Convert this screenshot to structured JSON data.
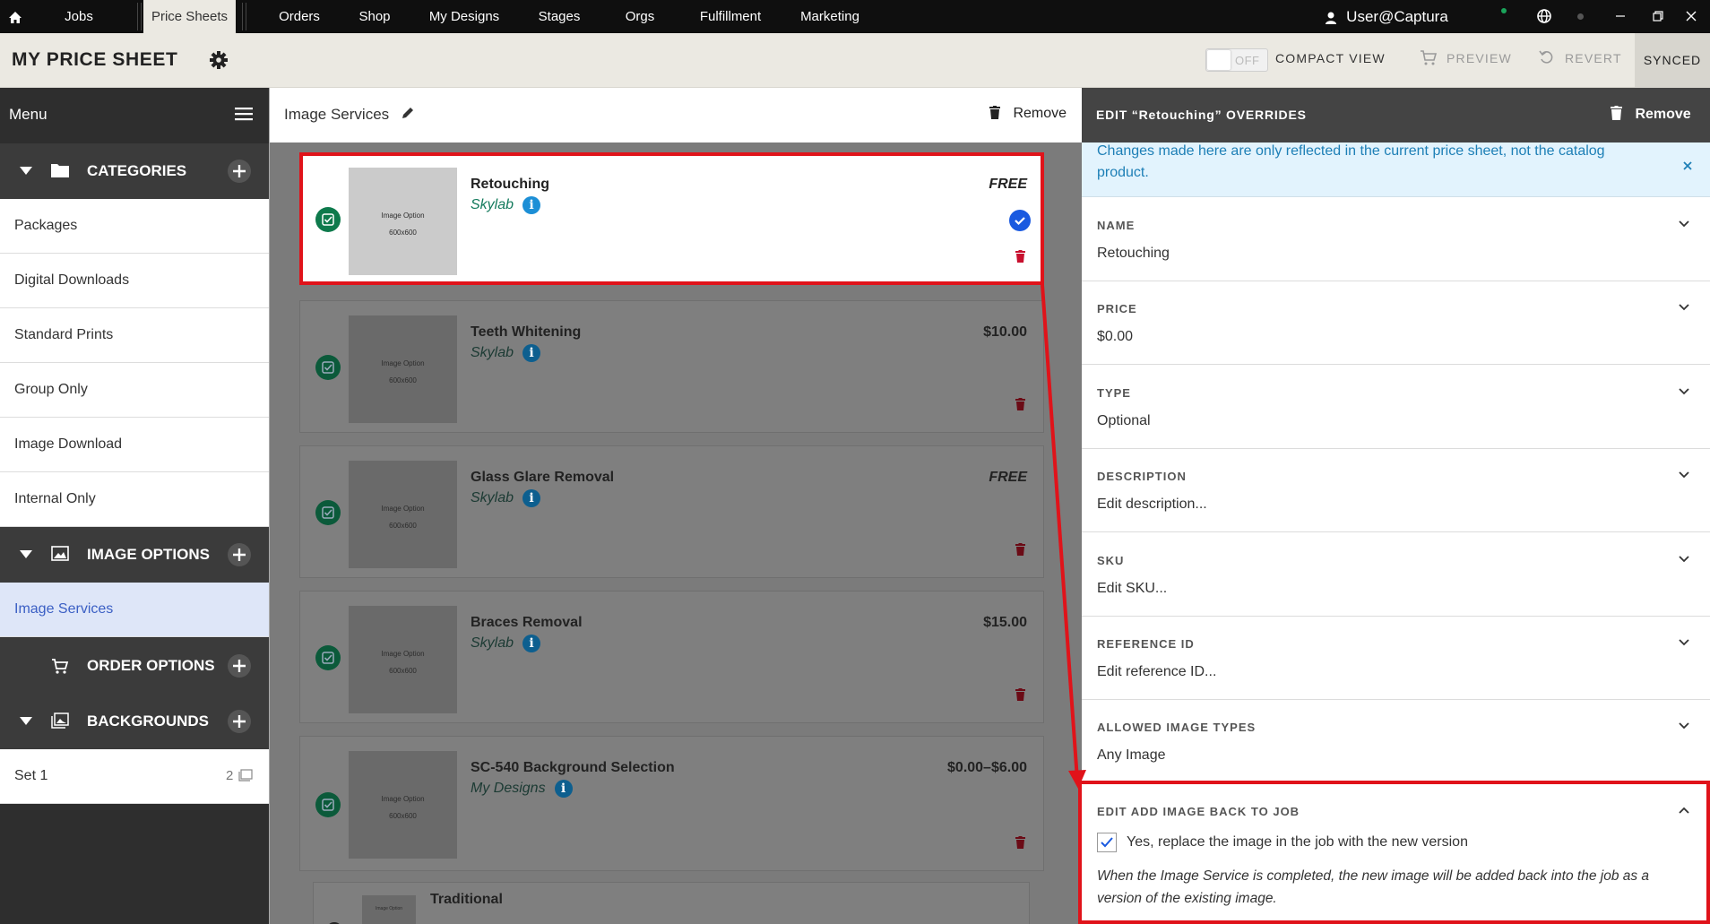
{
  "topnav": {
    "items": [
      "Jobs",
      "Price Sheets",
      "Orders",
      "Shop",
      "My Designs",
      "Stages",
      "Orgs",
      "Fulfillment",
      "Marketing"
    ],
    "user": "User@Captura"
  },
  "header": {
    "title": "MY PRICE SHEET",
    "toggle_state": "OFF",
    "compact_view": "COMPACT VIEW",
    "preview": "PREVIEW",
    "revert": "REVERT",
    "synced": "SYNCED"
  },
  "sidebar": {
    "menu_label": "Menu",
    "categories_label": "CATEGORIES",
    "categories": [
      "Packages",
      "Digital Downloads",
      "Standard Prints",
      "Group Only",
      "Image Download",
      "Internal Only"
    ],
    "image_options_label": "IMAGE OPTIONS",
    "image_options": [
      "Image Services"
    ],
    "order_options_label": "ORDER OPTIONS",
    "backgrounds_label": "BACKGROUNDS",
    "backgrounds": [
      {
        "label": "Set 1",
        "count": "2"
      }
    ]
  },
  "middle": {
    "title": "Image Services",
    "remove": "Remove",
    "thumb_line1": "Image Option",
    "thumb_line2": "600x600",
    "items": [
      {
        "name": "Retouching",
        "vendor": "Skylab",
        "price": "FREE"
      },
      {
        "name": "Teeth Whitening",
        "vendor": "Skylab",
        "price": "$10.00"
      },
      {
        "name": "Glass Glare Removal",
        "vendor": "Skylab",
        "price": "FREE"
      },
      {
        "name": "Braces Removal",
        "vendor": "Skylab",
        "price": "$15.00"
      },
      {
        "name": "SC-540 Background Selection",
        "vendor": "My Designs",
        "price": "$0.00–$6.00"
      },
      {
        "name": "Traditional",
        "vendor": "",
        "price": ""
      }
    ]
  },
  "right": {
    "title": "EDIT “Retouching” OVERRIDES",
    "remove": "Remove",
    "notice": "Changes made here are only reflected in the current price sheet, not the catalog product.",
    "fields": [
      {
        "label": "NAME",
        "value": "Retouching"
      },
      {
        "label": "PRICE",
        "value": "$0.00"
      },
      {
        "label": "TYPE",
        "value": "Optional"
      },
      {
        "label": "DESCRIPTION",
        "value": "Edit description..."
      },
      {
        "label": "SKU",
        "value": "Edit SKU..."
      },
      {
        "label": "REFERENCE ID",
        "value": "Edit reference ID..."
      },
      {
        "label": "ALLOWED IMAGE TYPES",
        "value": "Any Image"
      }
    ],
    "add_back": {
      "label": "EDIT ADD IMAGE BACK TO JOB",
      "checkbox_label": "Yes, replace the image in the job with the new version",
      "checked": true,
      "description": "When the Image Service is completed, the new image will be added back into the job as a version of the existing image."
    }
  },
  "colors": {
    "highlight_red": "#e0131a",
    "accent_blue": "#1a5ae0",
    "check_green": "#0e7a4c",
    "trash_red": "#c8102e"
  }
}
